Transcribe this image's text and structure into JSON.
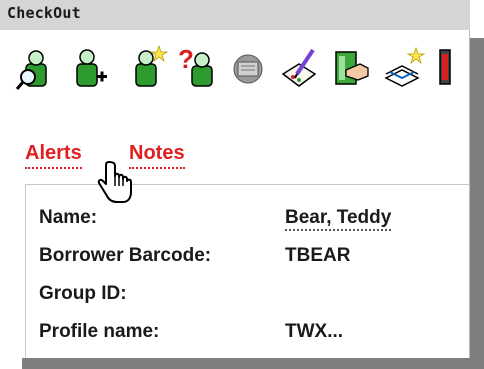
{
  "window": {
    "title": "CheckOut"
  },
  "toolbar": {
    "buttons": [
      {
        "icon": "find-patron-icon"
      },
      {
        "icon": "add-patron-icon"
      },
      {
        "icon": "new-patron-icon"
      },
      {
        "icon": "patron-query-icon"
      },
      {
        "icon": "library-card-icon"
      },
      {
        "icon": "edit-notes-icon"
      },
      {
        "icon": "check-in-icon"
      },
      {
        "icon": "book-sparkle-icon"
      }
    ]
  },
  "tabs": {
    "alerts": "Alerts",
    "notes": "Notes"
  },
  "patron": {
    "name_label": "Name:",
    "name_value": "Bear, Teddy",
    "barcode_label": "Borrower Barcode:",
    "barcode_value": "TBEAR",
    "group_label": "Group ID:",
    "group_value": "",
    "profile_label": "Profile name:",
    "profile_value": "TWX..."
  },
  "colors": {
    "tab_red": "#e02020",
    "titlebar_gray": "#d5d5d5",
    "shadow_gray": "#7f7f7f",
    "patron_green": "#2e9b2e"
  }
}
